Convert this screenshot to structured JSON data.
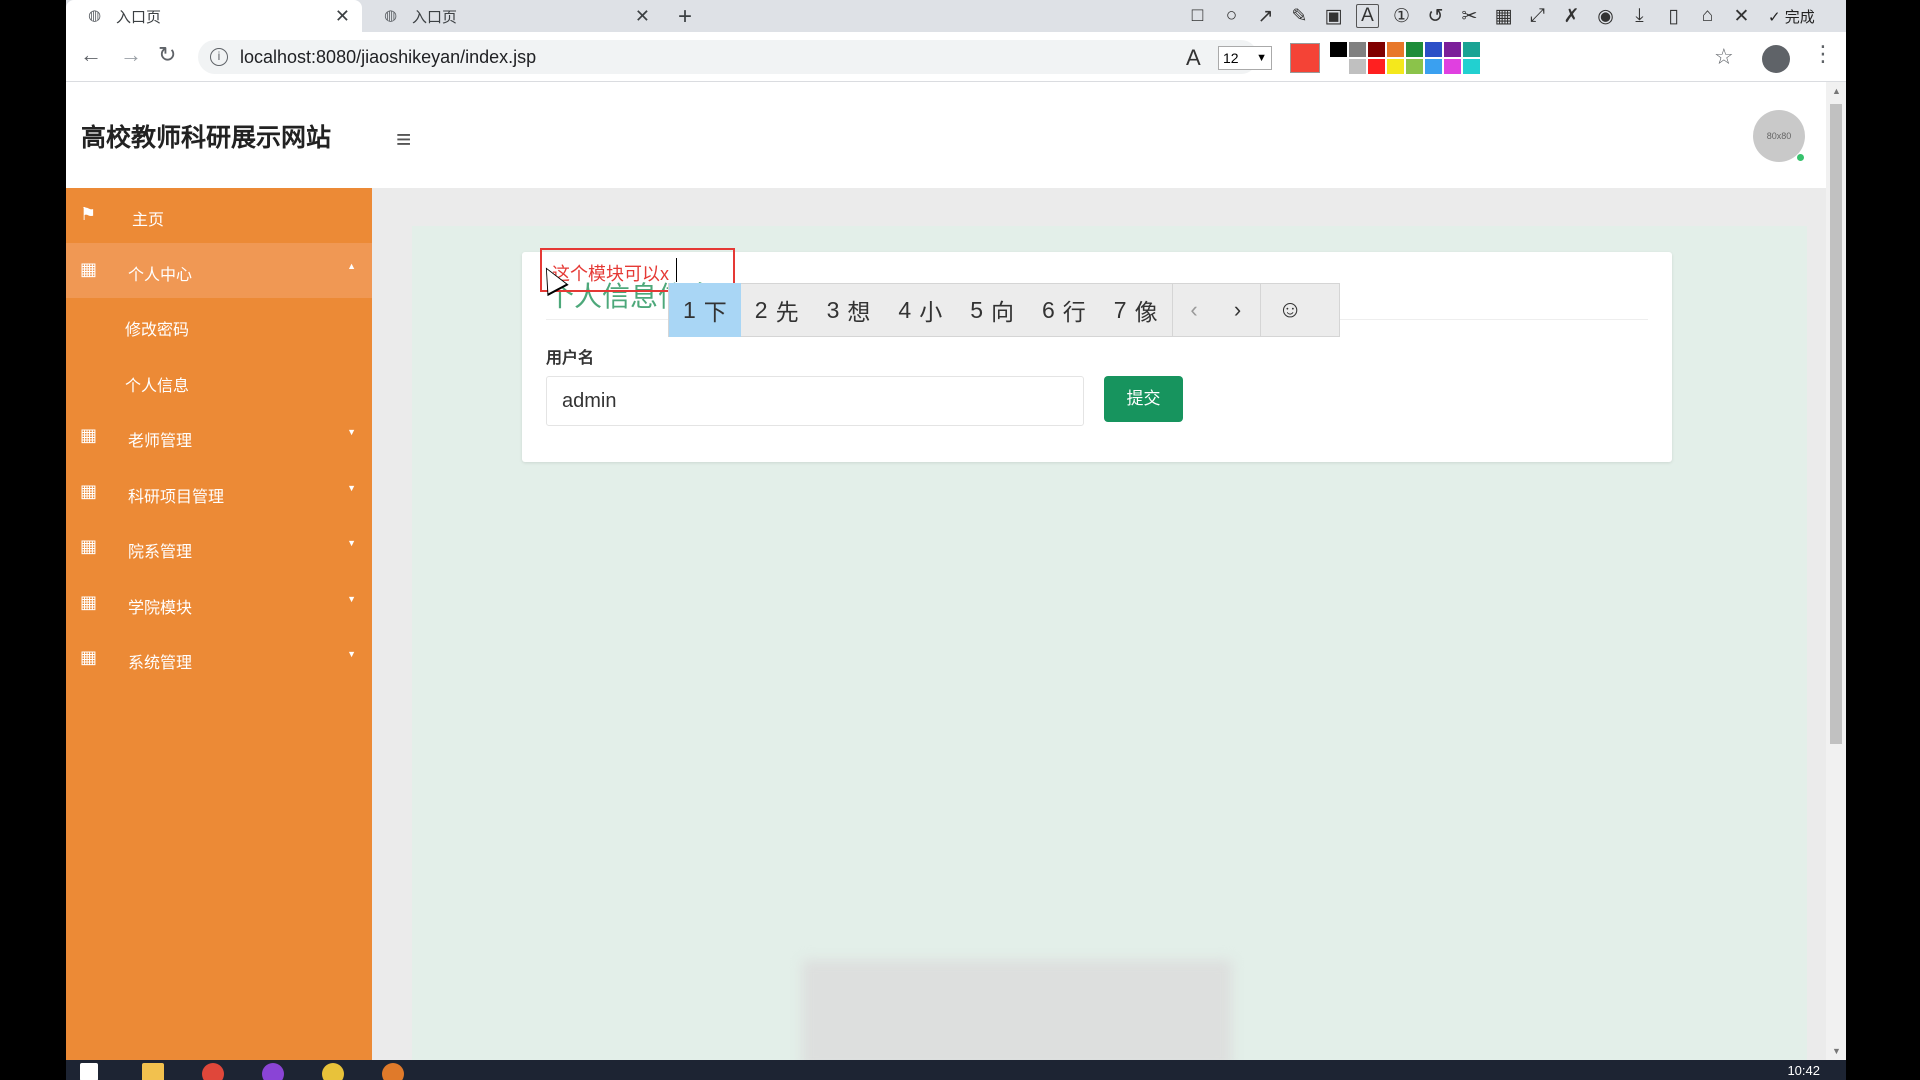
{
  "browser": {
    "tabs": [
      {
        "title": "入口页",
        "active": true
      },
      {
        "title": "入口页",
        "active": false
      }
    ],
    "url": "localhost:8080/jiaoshikeyan/index.jsp",
    "annotation_toolbar": {
      "done_label": "完成",
      "font_size": "12",
      "current_color": "#f44336",
      "palette": [
        "#000000",
        "#808080",
        "#800000",
        "#e8782a",
        "#1e8c3a",
        "#2c4fc7",
        "#7b1f9a",
        "#1aa394",
        "#ffffff",
        "#c0c0c0",
        "#ff2020",
        "#f4e81c",
        "#8bc34a",
        "#3aa0f0",
        "#e040e0",
        "#22d0d0"
      ]
    }
  },
  "header": {
    "site_title": "高校教师科研展示网站",
    "avatar_text": "80x80"
  },
  "sidebar": {
    "items": [
      {
        "label": "主页",
        "icon": "flag-icon"
      },
      {
        "label": "个人中心",
        "icon": "grid-icon",
        "open": true,
        "children": [
          "修改密码",
          "个人信息"
        ]
      },
      {
        "label": "老师管理",
        "icon": "grid-icon"
      },
      {
        "label": "科研项目管理",
        "icon": "grid-icon"
      },
      {
        "label": "院系管理",
        "icon": "grid-icon"
      },
      {
        "label": "学院模块",
        "icon": "grid-icon"
      },
      {
        "label": "系统管理",
        "icon": "grid-icon"
      }
    ]
  },
  "form": {
    "title": "个人信息信息",
    "username_label": "用户名",
    "username_value": "admin",
    "submit_label": "提交"
  },
  "annotation": {
    "text": "这个模块可以x"
  },
  "ime": {
    "candidates": [
      {
        "num": "1",
        "char": "下"
      },
      {
        "num": "2",
        "char": "先"
      },
      {
        "num": "3",
        "char": "想"
      },
      {
        "num": "4",
        "char": "小"
      },
      {
        "num": "5",
        "char": "向"
      },
      {
        "num": "6",
        "char": "行"
      },
      {
        "num": "7",
        "char": "像"
      }
    ],
    "selected_index": 0
  },
  "taskbar": {
    "clock": "10:42"
  }
}
